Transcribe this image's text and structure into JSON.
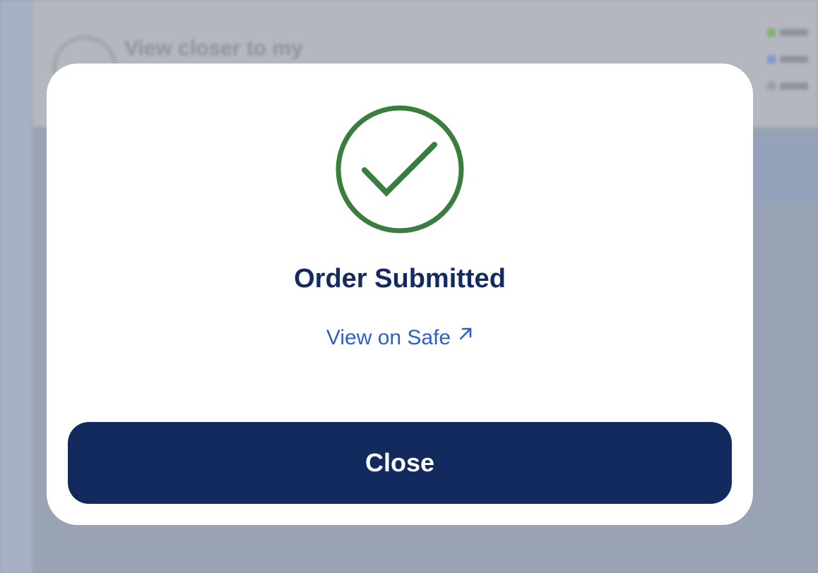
{
  "background": {
    "panel_title": "View closer to my"
  },
  "modal": {
    "status_icon": "check-circle-icon",
    "status_color": "#3a7d3e",
    "title": "Order Submitted",
    "link_text": "View on Safe",
    "link_icon": "external-arrow-icon",
    "link_color": "#2a62c9",
    "close_label": "Close",
    "close_bg": "#132a5f"
  }
}
